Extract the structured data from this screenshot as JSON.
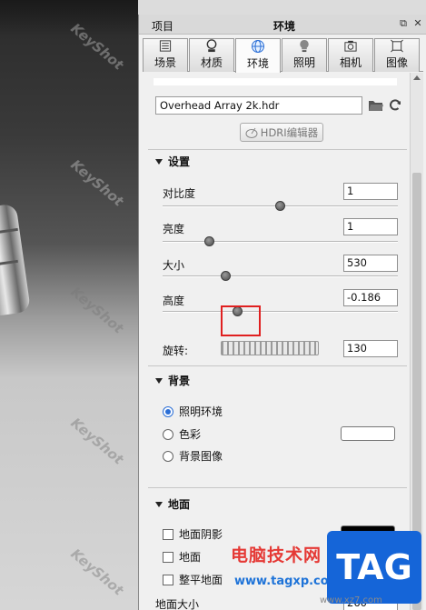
{
  "viewport": {
    "watermark": "KeyShot"
  },
  "panel": {
    "title_left": "项目",
    "title_center": "环境"
  },
  "tabs": [
    {
      "label": "场景",
      "icon": "scene-icon"
    },
    {
      "label": "材质",
      "icon": "material-icon"
    },
    {
      "label": "环境",
      "icon": "globe-icon",
      "active": true
    },
    {
      "label": "照明",
      "icon": "bulb-icon"
    },
    {
      "label": "相机",
      "icon": "camera-icon"
    },
    {
      "label": "图像",
      "icon": "image-icon"
    }
  ],
  "hdr": {
    "file_name": "Overhead Array 2k.hdr",
    "editor_button": "HDRI编辑器"
  },
  "settings": {
    "section_title": "设置",
    "contrast": {
      "label": "对比度",
      "value": "1",
      "slider_fraction": 0.5
    },
    "brightness": {
      "label": "亮度",
      "value": "1",
      "slider_fraction": 0.2
    },
    "size": {
      "label": "大小",
      "value": "530",
      "slider_fraction": 0.27
    },
    "height": {
      "label": "高度",
      "value": "-0.186",
      "slider_fraction": 0.32
    },
    "rotation": {
      "label": "旋转:",
      "value": "130"
    }
  },
  "background": {
    "section_title": "背景",
    "options": [
      "照明环境",
      "色彩",
      "背景图像"
    ],
    "selected_index": 0,
    "color_swatch": "#ffffff"
  },
  "ground": {
    "section_title": "地面",
    "options": [
      "地面阴影",
      "地面",
      "整平地面"
    ],
    "shadow_color": "#000000",
    "size_label": "地面大小",
    "size_value": "260"
  },
  "overlay": {
    "site_name": "电脑技术网",
    "site_url": "www.tagxp.com",
    "badge": "TAG",
    "site_url2": "www.xz7.com"
  },
  "colors": {
    "accent_blue": "#2a6ed6",
    "highlight_red": "#e02020"
  }
}
